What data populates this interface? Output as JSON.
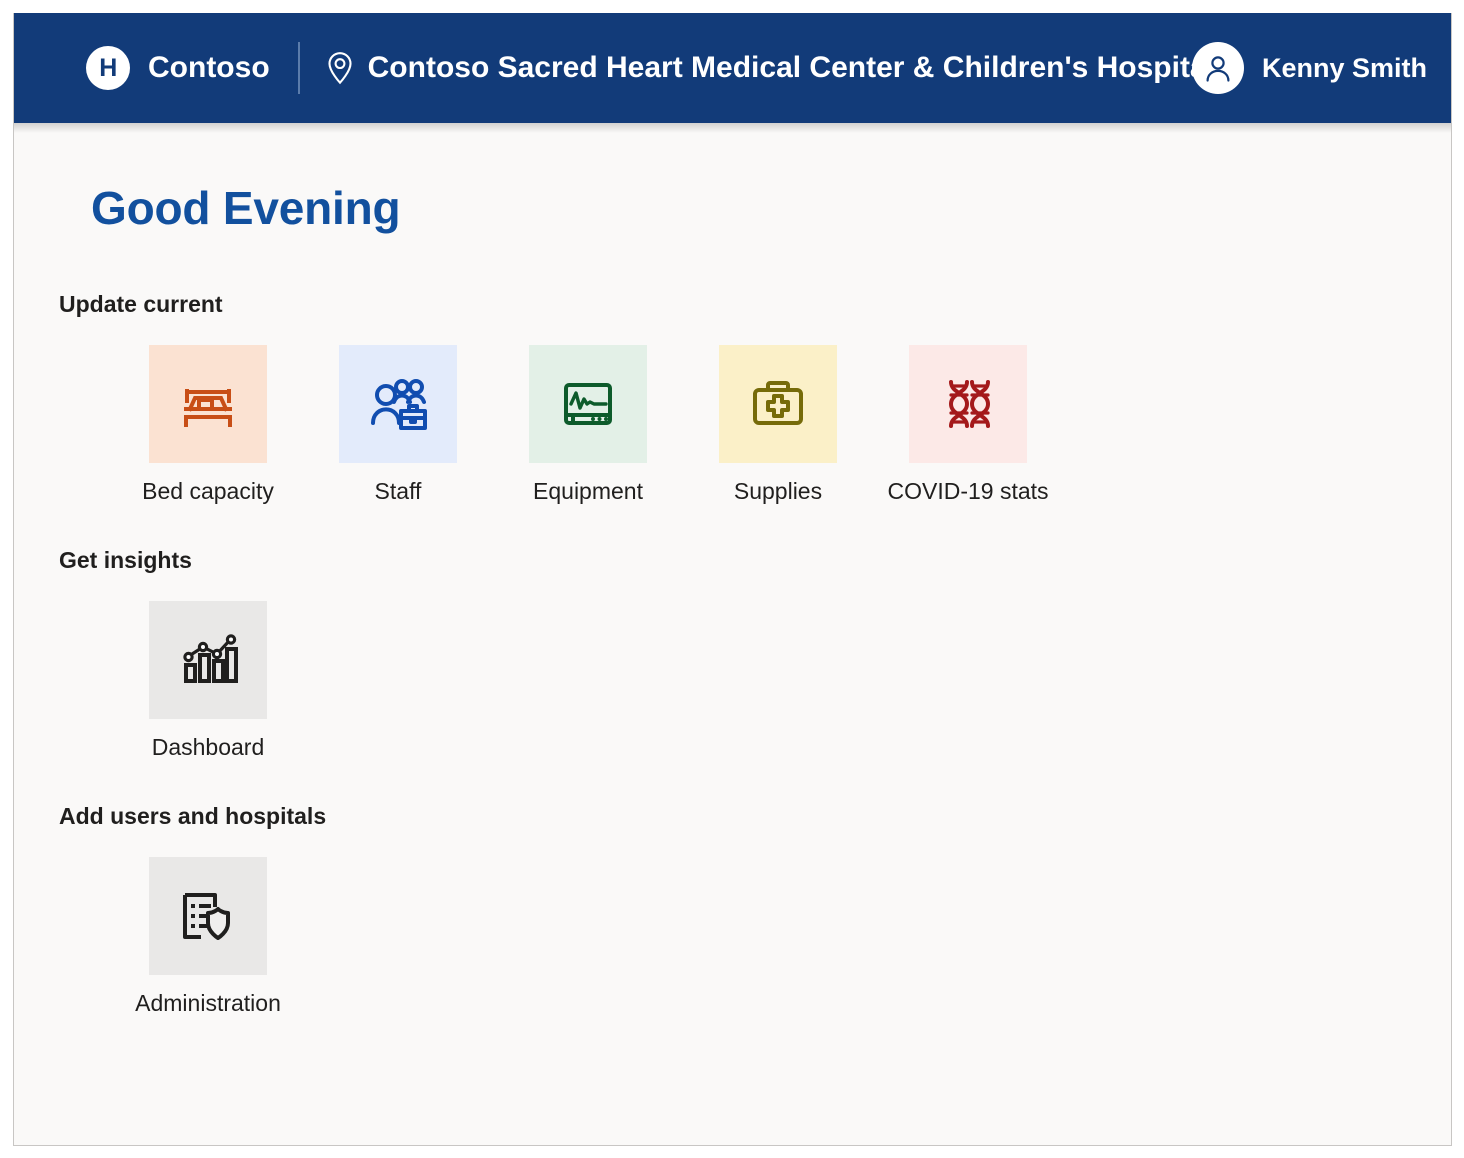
{
  "header": {
    "logo_letter": "H",
    "brand_name": "Contoso",
    "site_icon": "location-pin-icon",
    "site_name": "Contoso Sacred Heart Medical Center & Children's Hospital",
    "user_icon": "person-avatar-icon",
    "user_name": "Kenny Smith",
    "background_color": "#123B79"
  },
  "main": {
    "greeting": "Good Evening",
    "greeting_color": "#12509E",
    "sections": [
      {
        "title": "Update current",
        "tiles": [
          {
            "label": "Bed capacity",
            "icon": "bed-icon",
            "bg": "#FBE2D2",
            "fg": "#C84E16"
          },
          {
            "label": "Staff",
            "icon": "people-briefcase-icon",
            "bg": "#E3EBFB",
            "fg": "#114DB0"
          },
          {
            "label": "Equipment",
            "icon": "heart-monitor-icon",
            "bg": "#E3F0E7",
            "fg": "#0D5B2B"
          },
          {
            "label": "Supplies",
            "icon": "first-aid-kit-icon",
            "bg": "#FBF0C8",
            "fg": "#766B09"
          },
          {
            "label": "COVID-19 stats",
            "icon": "dna-helix-icon",
            "bg": "#FCE9E7",
            "fg": "#A4191B"
          }
        ]
      },
      {
        "title": "Get insights",
        "tiles": [
          {
            "label": "Dashboard",
            "icon": "bar-chart-trend-icon",
            "bg": "#E9E8E7",
            "fg": "#201F1E"
          }
        ]
      },
      {
        "title": "Add users and hospitals",
        "tiles": [
          {
            "label": "Administration",
            "icon": "document-shield-icon",
            "bg": "#E9E8E7",
            "fg": "#201F1E"
          }
        ]
      }
    ]
  }
}
